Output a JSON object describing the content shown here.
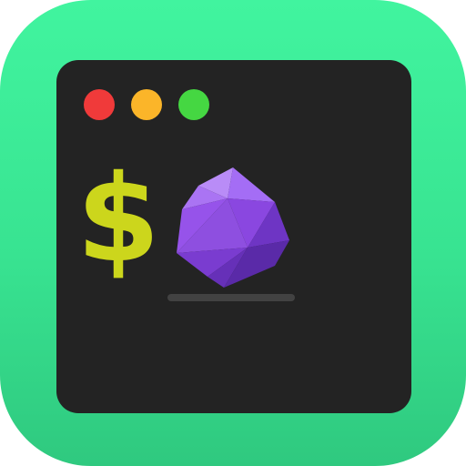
{
  "icon": {
    "name": "terminal-app-icon",
    "background_color": "#3ae896"
  },
  "window": {
    "background_color": "#232323",
    "traffic_lights": [
      {
        "name": "close",
        "color": "#f03a3a"
      },
      {
        "name": "minimize",
        "color": "#fbb529"
      },
      {
        "name": "zoom",
        "color": "#45d742"
      }
    ]
  },
  "prompt": {
    "symbol": "$",
    "color": "#ccd61c"
  },
  "gem": {
    "icon": "purple-icosahedron-gem",
    "colors": [
      "#9a5af0",
      "#7d3fd6",
      "#5a2aa8"
    ]
  },
  "cursor": {
    "color": "#424242"
  }
}
